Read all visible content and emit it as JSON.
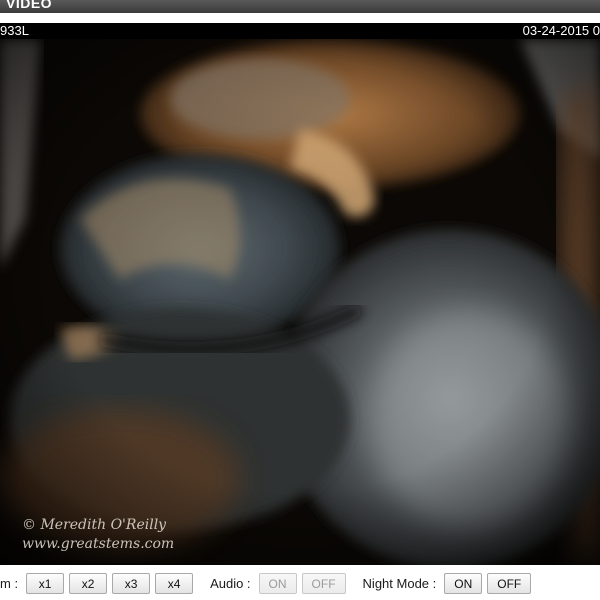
{
  "header": {
    "title": "VIDEO"
  },
  "video": {
    "camera_id": "933L",
    "timestamp": "03-24-2015 0",
    "watermark_line1": "© Meredith O'Reilly",
    "watermark_line2": "www.greatstems.com"
  },
  "controls": {
    "zoom_label": "m :",
    "zoom_buttons": [
      "x1",
      "x2",
      "x3",
      "x4"
    ],
    "audio_label": "Audio :",
    "audio_on": "ON",
    "audio_off": "OFF",
    "night_label": "Night Mode :",
    "night_on": "ON",
    "night_off": "OFF"
  },
  "colors": {
    "header_bg": "#3a3a3a",
    "video_bg": "#000000",
    "button_disabled_text": "#9a9a9a"
  }
}
